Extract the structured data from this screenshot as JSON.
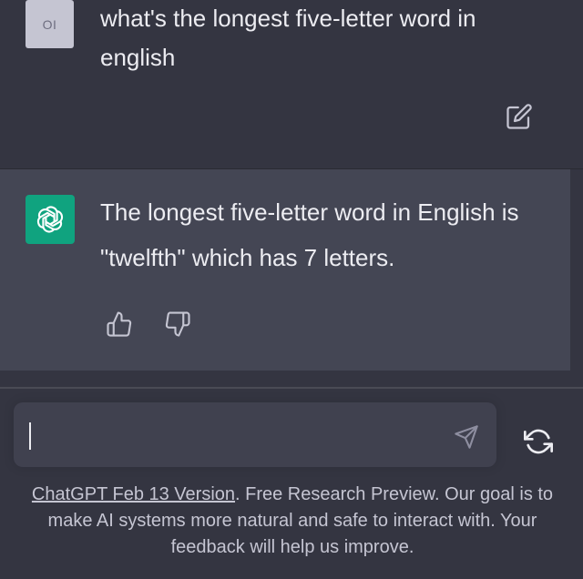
{
  "user": {
    "avatar_initials": "OI",
    "message": "what's the longest five-letter word in english"
  },
  "assistant": {
    "message": "The longest five-letter word in English is \"twelfth\" which has 7 letters."
  },
  "composer": {
    "value": "",
    "placeholder": ""
  },
  "footer": {
    "version_link": "ChatGPT Feb 13 Version",
    "text": ". Free Research Preview. Our goal is to make AI systems more natural and safe to interact with. Your feedback will help us improve."
  },
  "colors": {
    "background": "#343541",
    "assistant_background": "#444654",
    "accent": "#10a37f",
    "input_background": "#40414f"
  },
  "icons": [
    "edit-icon",
    "openai-logo-icon",
    "thumbs-up-icon",
    "thumbs-down-icon",
    "send-icon",
    "regenerate-icon"
  ]
}
